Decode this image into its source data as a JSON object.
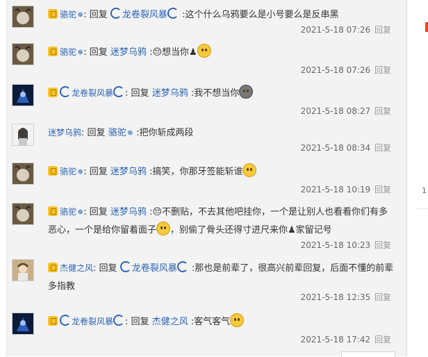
{
  "reply_word": "回复",
  "reply_link": "回复",
  "colors": {
    "username": "#2d64b3",
    "panel_bg": "#f3f3f3",
    "accent_mark": "#e84a1f"
  },
  "right_edge": {
    "number": "1"
  },
  "replies": [
    {
      "user": "骆驼",
      "badge": "✵",
      "target": "龙卷裂风暴",
      "text": ":这个什么乌鸦要么是小号要么是反串黑",
      "time": "2021-5-18 07:26"
    },
    {
      "user": "骆驼",
      "badge": "✵",
      "target": "迷梦乌鸦",
      "text": ":😔想当你♟",
      "time": "2021-5-18 07:26"
    },
    {
      "user": "龙卷裂风暴",
      "badge": "",
      "target": "迷梦乌鸦",
      "text": ":我不想当你",
      "time": "2021-5-18 08:27"
    },
    {
      "user": "迷梦乌鸦",
      "badge": "",
      "target": "骆驼",
      "text": ":把你斩成两段",
      "time": "2021-5-18 08:34"
    },
    {
      "user": "骆驼",
      "badge": "✵",
      "target": "迷梦乌鸦",
      "text": ":搞笑，你那牙签能斩谁",
      "time": "2021-5-18 10:19"
    },
    {
      "user": "骆驼",
      "badge": "✵",
      "target": "迷梦乌鸦",
      "text": ":😔不删贴，不去其他吧挂你，一个是让别人也看看你们有多恶心，一个是给你留着面子",
      "text2": "，别偷了骨头还得寸进尺来你♟家留记号",
      "time": "2021-5-18 10:23"
    },
    {
      "user": "杰健之风",
      "badge": "",
      "target": "龙卷裂风暴",
      "text": ":那也是前辈了，很高兴前辈回复，后面不懂的前辈多指教",
      "time": "2021-5-18 12:35"
    },
    {
      "user": "龙卷裂风暴",
      "badge": "",
      "target": "杰健之风",
      "text": ":客气客气",
      "time": "2021-5-18 17:42"
    }
  ]
}
